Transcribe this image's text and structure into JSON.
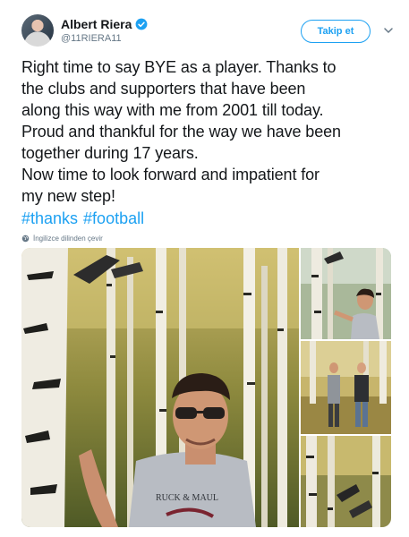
{
  "header": {
    "display_name": "Albert Riera",
    "handle": "@11RIERA11",
    "follow_label": "Takip et"
  },
  "tweet": {
    "lines": [
      "Right time to say BYE as a player. Thanks to",
      "the clubs and supporters that have been",
      "along this way with me from 2001 till today.",
      "Proud and thankful for the way we have been",
      "together during 17 years.",
      "Now time to look forward and impatient for",
      "my new step!"
    ],
    "hashtags": [
      "#thanks",
      "#football"
    ]
  },
  "translate": {
    "label": "İngilizce dilinden çevir"
  },
  "media": {
    "shirt_text": "RUCK & MAUL"
  },
  "colors": {
    "accent": "#1da1f2",
    "text": "#14171a",
    "secondary": "#657786"
  },
  "icons": [
    "verified-badge-icon",
    "chevron-down-icon",
    "globe-icon"
  ]
}
